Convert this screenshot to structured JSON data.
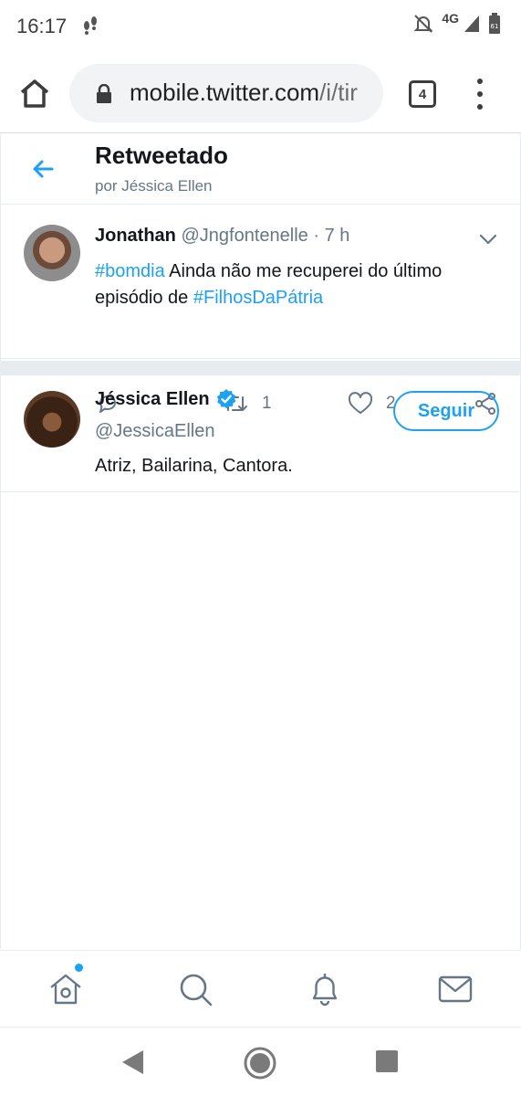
{
  "status_bar": {
    "time": "16:17",
    "network": "4G",
    "battery_level": "61"
  },
  "browser": {
    "url_host": "mobile.twitter.com",
    "url_path": "/i/tir",
    "tab_count": "4"
  },
  "header": {
    "title": "Retweetado",
    "subtitle": "por Jéssica Ellen"
  },
  "tweet": {
    "name": "Jonathan",
    "handle": "@Jngfontenelle",
    "separator": "·",
    "time": "7 h",
    "hashtag1": "#bomdia",
    "text_part1": " Ainda não me recuperei do último episódio de ",
    "hashtag2": "#FilhosDaPátria",
    "retweet_count": "1",
    "like_count": "2"
  },
  "user": {
    "name": "Jéssica Ellen",
    "handle": "@JessicaEllen",
    "bio": "Atriz, Bailarina, Cantora.",
    "follow_label": "Seguir",
    "verified": true
  },
  "colors": {
    "accent": "#1da1f2",
    "secondary_text": "#657786",
    "divider": "#e6ecf0"
  },
  "icons": [
    "home-icon",
    "lock-icon",
    "tabs-icon",
    "menu-icon",
    "back-arrow-icon",
    "chevron-down-icon",
    "reply-icon",
    "retweet-icon",
    "like-icon",
    "share-icon",
    "verified-icon",
    "search-icon",
    "notifications-icon",
    "messages-icon"
  ]
}
